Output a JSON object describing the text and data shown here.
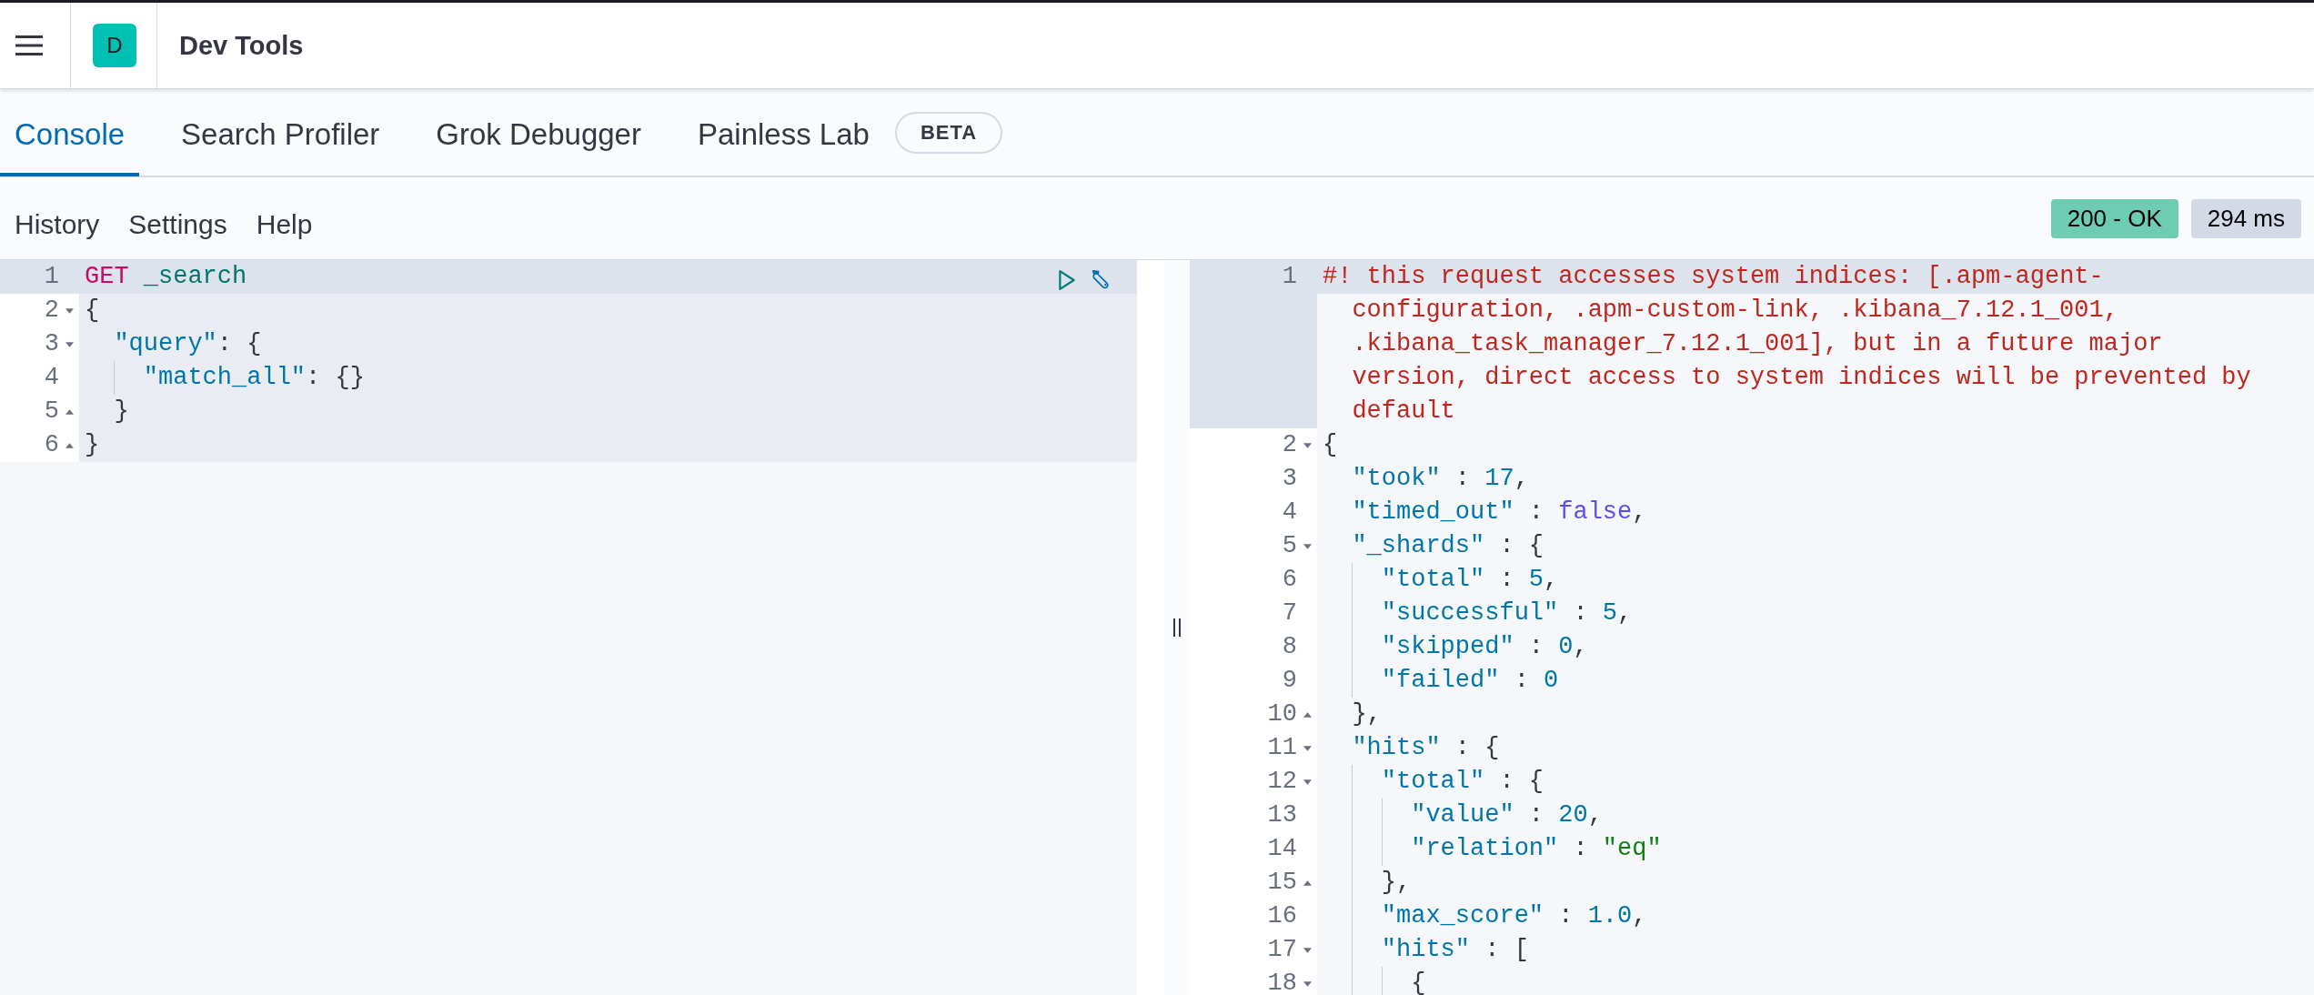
{
  "header": {
    "app_initial": "D",
    "title": "Dev Tools"
  },
  "tabs": [
    {
      "label": "Console",
      "selected": true
    },
    {
      "label": "Search Profiler",
      "selected": false
    },
    {
      "label": "Grok Debugger",
      "selected": false
    },
    {
      "label": "Painless Lab",
      "selected": false,
      "badge": "BETA"
    }
  ],
  "toolbar": {
    "links": [
      "History",
      "Settings",
      "Help"
    ],
    "status": {
      "text": "200 - OK",
      "kind": "success"
    },
    "duration": "294 ms"
  },
  "request_editor": {
    "lines": [
      {
        "number": "1",
        "current": true,
        "tokens": [
          {
            "kind": "method",
            "text": "GET"
          },
          {
            "kind": "path",
            "text": " _search"
          }
        ]
      },
      {
        "number": "2",
        "fold_start": true,
        "current": false,
        "in_request": true,
        "tokens": [
          {
            "kind": "punct",
            "text": "{"
          }
        ]
      },
      {
        "number": "3",
        "fold_start": true,
        "current": false,
        "in_request": true,
        "tokens": [
          {
            "kind": "key",
            "text": "  \"query\""
          },
          {
            "kind": "punct",
            "text": ": {"
          }
        ]
      },
      {
        "number": "4",
        "current": false,
        "in_request": true,
        "tokens": [
          {
            "kind": "key",
            "text": "    \"match_all\""
          },
          {
            "kind": "punct",
            "text": ": {}"
          }
        ]
      },
      {
        "number": "5",
        "fold_end": true,
        "current": false,
        "in_request": true,
        "tokens": [
          {
            "kind": "punct",
            "text": "  }"
          }
        ]
      },
      {
        "number": "6",
        "fold_end": true,
        "current": false,
        "in_request": true,
        "tokens": [
          {
            "kind": "punct",
            "text": "}"
          }
        ]
      }
    ]
  },
  "response_editor": {
    "lines": [
      {
        "number": "1",
        "current": true,
        "tokens": [
          {
            "kind": "comment",
            "text": "#! this request accesses system indices: [.apm-agent-configuration, .apm-custom-link, .kibana_7.12.1_001, .kibana_task_manager_7.12.1_001], but in a future major version, direct access to system indices will be prevented by default"
          }
        ]
      },
      {
        "number": "2",
        "fold_start": true,
        "current": false,
        "in_request": false,
        "tokens": [
          {
            "kind": "punct",
            "text": "{"
          }
        ]
      },
      {
        "number": "3",
        "current": false,
        "in_request": false,
        "tokens": [
          {
            "kind": "key",
            "text": "  \"took\""
          },
          {
            "kind": "punct",
            "text": " : "
          },
          {
            "kind": "number",
            "text": "17"
          },
          {
            "kind": "punct",
            "text": ","
          }
        ]
      },
      {
        "number": "4",
        "current": false,
        "in_request": false,
        "tokens": [
          {
            "kind": "key",
            "text": "  \"timed_out\""
          },
          {
            "kind": "punct",
            "text": " : "
          },
          {
            "kind": "boolean",
            "text": "false"
          },
          {
            "kind": "punct",
            "text": ","
          }
        ]
      },
      {
        "number": "5",
        "fold_start": true,
        "current": false,
        "in_request": false,
        "tokens": [
          {
            "kind": "key",
            "text": "  \"_shards\""
          },
          {
            "kind": "punct",
            "text": " : {"
          }
        ]
      },
      {
        "number": "6",
        "current": false,
        "in_request": false,
        "tokens": [
          {
            "kind": "key",
            "text": "    \"total\""
          },
          {
            "kind": "punct",
            "text": " : "
          },
          {
            "kind": "number",
            "text": "5"
          },
          {
            "kind": "punct",
            "text": ","
          }
        ]
      },
      {
        "number": "7",
        "current": false,
        "in_request": false,
        "tokens": [
          {
            "kind": "key",
            "text": "    \"successful\""
          },
          {
            "kind": "punct",
            "text": " : "
          },
          {
            "kind": "number",
            "text": "5"
          },
          {
            "kind": "punct",
            "text": ","
          }
        ]
      },
      {
        "number": "8",
        "current": false,
        "in_request": false,
        "tokens": [
          {
            "kind": "key",
            "text": "    \"skipped\""
          },
          {
            "kind": "punct",
            "text": " : "
          },
          {
            "kind": "number",
            "text": "0"
          },
          {
            "kind": "punct",
            "text": ","
          }
        ]
      },
      {
        "number": "9",
        "current": false,
        "in_request": false,
        "tokens": [
          {
            "kind": "key",
            "text": "    \"failed\""
          },
          {
            "kind": "punct",
            "text": " : "
          },
          {
            "kind": "number",
            "text": "0"
          }
        ]
      },
      {
        "number": "10",
        "fold_end": true,
        "current": false,
        "in_request": false,
        "tokens": [
          {
            "kind": "punct",
            "text": "  },"
          }
        ]
      },
      {
        "number": "11",
        "fold_start": true,
        "current": false,
        "in_request": false,
        "tokens": [
          {
            "kind": "key",
            "text": "  \"hits\""
          },
          {
            "kind": "punct",
            "text": " : {"
          }
        ]
      },
      {
        "number": "12",
        "fold_start": true,
        "current": false,
        "in_request": false,
        "tokens": [
          {
            "kind": "key",
            "text": "    \"total\""
          },
          {
            "kind": "punct",
            "text": " : {"
          }
        ]
      },
      {
        "number": "13",
        "current": false,
        "in_request": false,
        "tokens": [
          {
            "kind": "key",
            "text": "      \"value\""
          },
          {
            "kind": "punct",
            "text": " : "
          },
          {
            "kind": "number",
            "text": "20"
          },
          {
            "kind": "punct",
            "text": ","
          }
        ]
      },
      {
        "number": "14",
        "current": false,
        "in_request": false,
        "tokens": [
          {
            "kind": "key",
            "text": "      \"relation\""
          },
          {
            "kind": "punct",
            "text": " : "
          },
          {
            "kind": "string",
            "text": "\"eq\""
          }
        ]
      },
      {
        "number": "15",
        "fold_end": true,
        "current": false,
        "in_request": false,
        "tokens": [
          {
            "kind": "punct",
            "text": "    },"
          }
        ]
      },
      {
        "number": "16",
        "current": false,
        "in_request": false,
        "tokens": [
          {
            "kind": "key",
            "text": "    \"max_score\""
          },
          {
            "kind": "punct",
            "text": " : "
          },
          {
            "kind": "number",
            "text": "1.0"
          },
          {
            "kind": "punct",
            "text": ","
          }
        ]
      },
      {
        "number": "17",
        "fold_start": true,
        "current": false,
        "in_request": false,
        "tokens": [
          {
            "kind": "key",
            "text": "    \"hits\""
          },
          {
            "kind": "punct",
            "text": " : ["
          }
        ]
      },
      {
        "number": "18",
        "fold_start": true,
        "current": false,
        "in_request": false,
        "tokens": [
          {
            "kind": "punct",
            "text": "      {"
          }
        ]
      }
    ]
  }
}
